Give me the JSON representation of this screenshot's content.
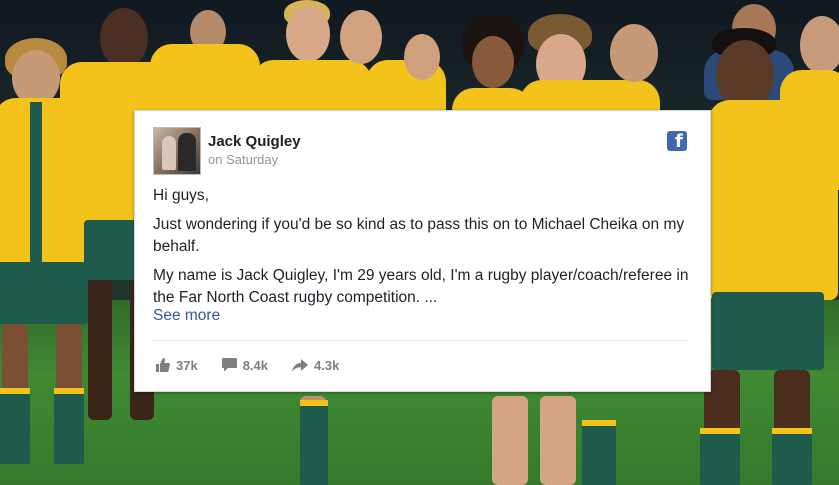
{
  "post": {
    "author": "Jack Quigley",
    "time": "on Saturday",
    "paragraphs": [
      "Hi guys,",
      "Just wondering if you'd be so kind as to pass this on to Michael Cheika on my behalf.",
      "My name is Jack Quigley, I'm 29 years old, I'm a rugby player/coach/referee in the Far North Coast rugby competition. ..."
    ],
    "see_more": "See more",
    "likes": "37k",
    "comments": "8.4k",
    "shares": "4.3k"
  },
  "icons": {
    "brand": "facebook-icon",
    "like": "thumbs-up-icon",
    "comment": "comment-icon",
    "share": "share-arrow-icon"
  },
  "colors": {
    "facebook_blue": "#4267b2",
    "link": "#365899",
    "text": "#1d2129",
    "muted": "#90949c",
    "jersey_gold": "#f3c31b",
    "jersey_green": "#1f5b4c"
  }
}
